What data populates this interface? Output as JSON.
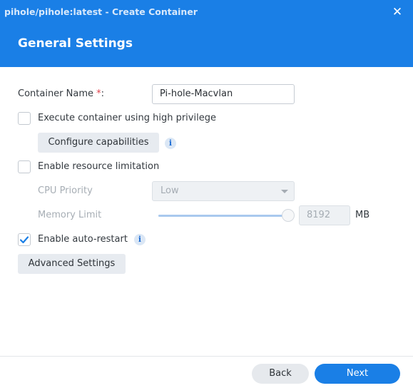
{
  "window": {
    "title": "pihole/pihole:latest - Create Container",
    "close_icon": "close-icon",
    "header_color": "#1a7fe6"
  },
  "section": {
    "title": "General Settings"
  },
  "form": {
    "container_name": {
      "label": "Container Name",
      "required_mark": "*",
      "suffix": ":",
      "value": "Pi-hole-Macvlan"
    },
    "high_privilege": {
      "label": "Execute container using high privilege",
      "checked": false
    },
    "configure_capabilities": {
      "label": "Configure capabilities",
      "info_icon": "info-icon"
    },
    "resource_limitation": {
      "label": "Enable resource limitation",
      "checked": false
    },
    "cpu_priority": {
      "label": "CPU Priority",
      "value": "Low",
      "disabled": true
    },
    "memory_limit": {
      "label": "Memory Limit",
      "value": "8192",
      "unit": "MB",
      "slider_level": 1.0,
      "disabled": true
    },
    "auto_restart": {
      "label": "Enable auto-restart",
      "checked": true,
      "info_icon": "info-icon"
    },
    "advanced_settings": {
      "label": "Advanced Settings"
    }
  },
  "footer": {
    "back_label": "Back",
    "next_label": "Next"
  },
  "info_glyph": "i"
}
